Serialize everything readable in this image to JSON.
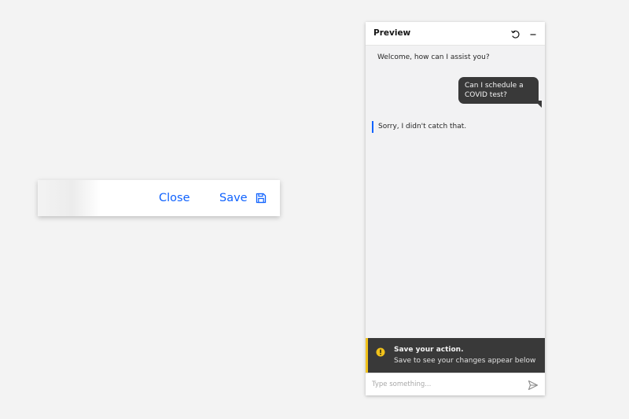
{
  "action_bar": {
    "close_label": "Close",
    "save_label": "Save",
    "accent_color": "#0f62fe",
    "save_icon": "save-icon"
  },
  "preview": {
    "title": "Preview",
    "header_icons": [
      "reset-icon",
      "minimize-icon"
    ],
    "messages": {
      "welcome": "Welcome, how can I assist you?",
      "user": "Can I schedule a COVID test?",
      "fallback": "Sorry, I didn't catch that."
    },
    "notification": {
      "title": "Save your action.",
      "subtitle": "Save to see your changes appear below",
      "icon": "warning-icon",
      "accent_color": "#f1c21b"
    },
    "input": {
      "placeholder": "Type something...",
      "value": "",
      "send_icon": "send-icon"
    }
  }
}
